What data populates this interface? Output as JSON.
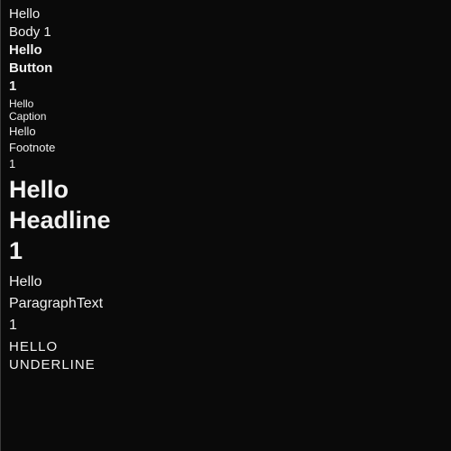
{
  "samples": {
    "body1": "Hello\nBody 1",
    "button": "Hello\nButton\n1",
    "caption": "Hello\nCaption",
    "footnote": "Hello\nFootnote\n1",
    "headline": "Hello\nHeadline\n1",
    "paragraph": "Hello\nParagraphText\n1",
    "underline": "HELLO\nUNDERLINE"
  },
  "colors": {
    "background": "#0a0a0a",
    "text": "#f0f0f0"
  }
}
